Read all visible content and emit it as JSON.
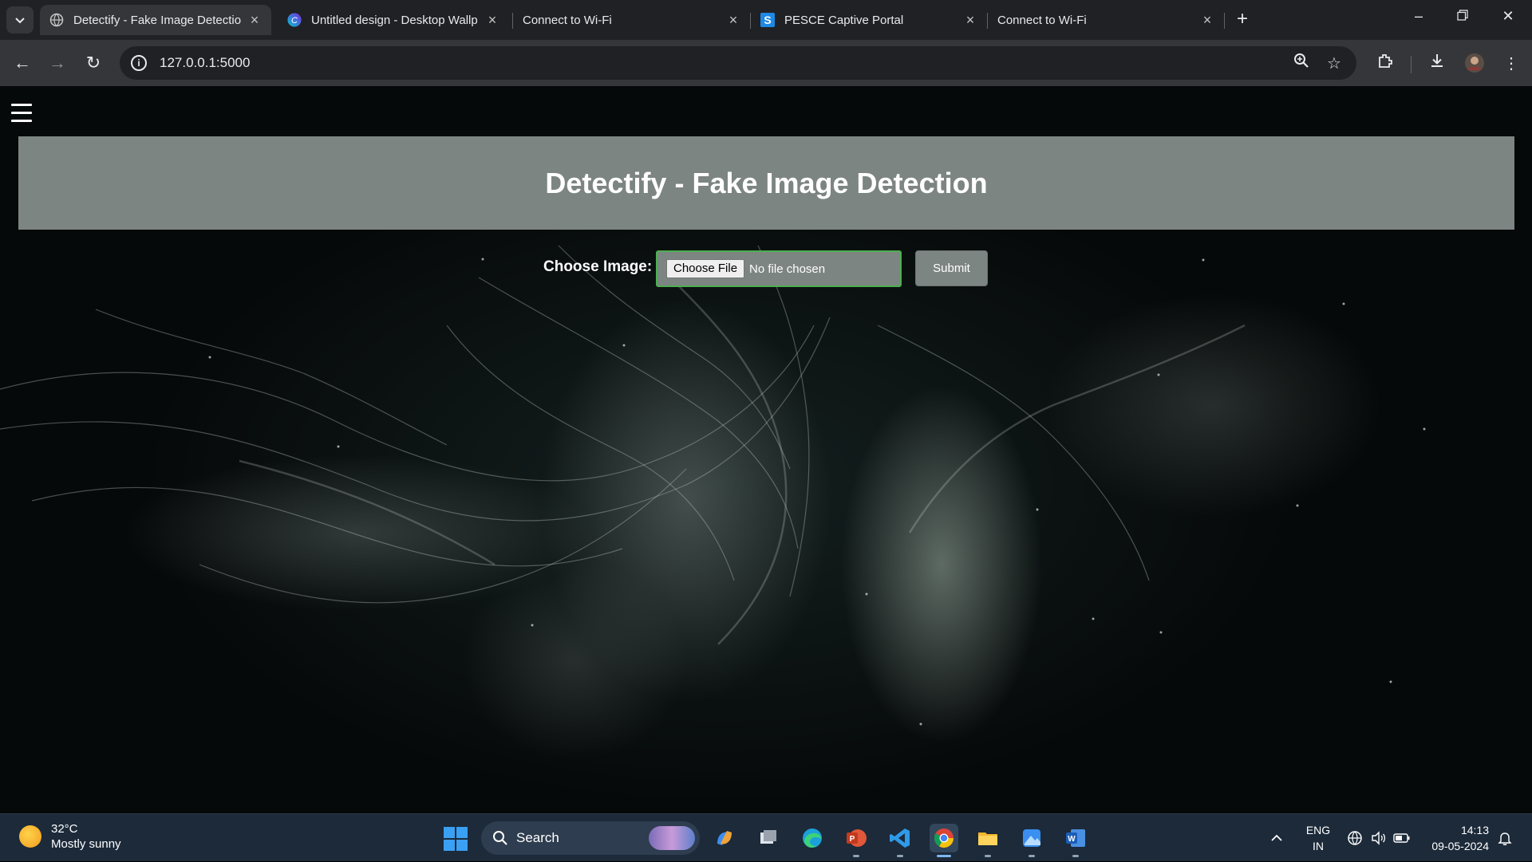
{
  "browser": {
    "tabs": [
      {
        "title": "Detectify - Fake Image Detectio",
        "icon": "globe-icon",
        "active": true
      },
      {
        "title": "Untitled design - Desktop Wallp",
        "icon": "canva-icon",
        "active": false
      },
      {
        "title": "Connect to Wi-Fi",
        "icon": "none",
        "active": false
      },
      {
        "title": "PESCE Captive Portal",
        "icon": "s-brand-icon",
        "active": false
      },
      {
        "title": "Connect to Wi-Fi",
        "icon": "none",
        "active": false
      }
    ],
    "new_tab": "+",
    "url": "127.0.0.1:5000"
  },
  "page": {
    "title": "Detectify - Fake Image Detection",
    "form": {
      "label": "Choose Image:",
      "file_button": "Choose File",
      "file_status": "No file chosen",
      "submit": "Submit"
    },
    "colors": {
      "header_bg": "#7d8582",
      "input_border": "#4caf50"
    }
  },
  "taskbar": {
    "weather_temp": "32°C",
    "weather_desc": "Mostly sunny",
    "search_label": "Search",
    "apps": [
      "copilot",
      "task-view",
      "edge",
      "powerpoint",
      "vscode",
      "chrome",
      "file-explorer",
      "photos",
      "word"
    ],
    "language_line1": "ENG",
    "language_line2": "IN",
    "time": "14:13",
    "date": "09-05-2024"
  }
}
